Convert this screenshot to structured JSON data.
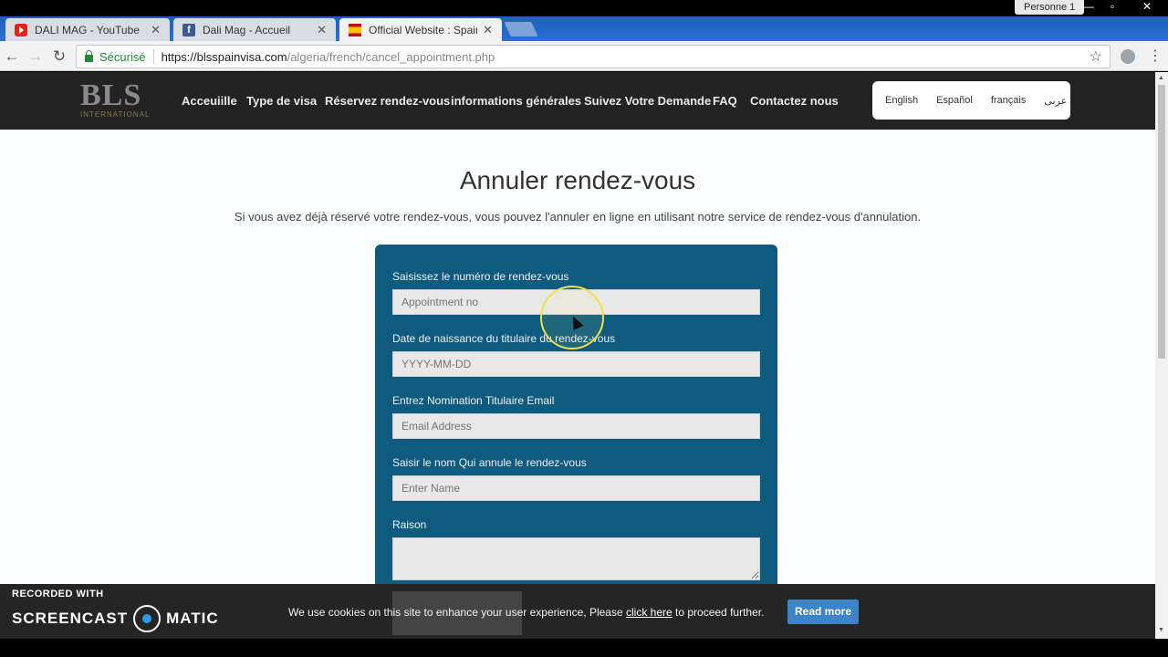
{
  "browser": {
    "tabs": [
      {
        "label": "DALI MAG - YouTube",
        "icon": "youtube-icon"
      },
      {
        "label": "Dali Mag - Accueil",
        "icon": "facebook-icon"
      },
      {
        "label": "Official Website : Spain V",
        "icon": "spain-flag-icon"
      }
    ],
    "profile": "Personne 1",
    "secure_label": "Sécurisé",
    "url_host": "https://blsspainvisa.com",
    "url_path": "/algeria/french/cancel_appointment.php"
  },
  "site": {
    "logo_text": "BLS",
    "logo_sub": "INTERNATIONAL",
    "menu": [
      "Acceuiille",
      "Type de visa",
      "Réservez rendez-vous",
      "informations générales",
      "Suivez Votre Demande",
      "FAQ",
      "Contactez nous"
    ],
    "languages": [
      "English",
      "Español",
      "français",
      "عربى"
    ]
  },
  "page": {
    "title": "Annuler rendez-vous",
    "intro": "Si vous avez déjà réservé votre rendez-vous, vous pouvez l'annuler en ligne en utilisant notre service de rendez-vous d'annulation."
  },
  "form": {
    "appointment_label": "Saisissez le numéro de rendez-vous",
    "appointment_placeholder": "Appointment no",
    "dob_label": "Date de naissance du titulaire du rendez-vous",
    "dob_placeholder": "YYYY-MM-DD",
    "email_label": "Entrez Nomination Titulaire Email",
    "email_placeholder": "Email Address",
    "name_label": "Saisir le nom Qui annule le rendez-vous",
    "name_placeholder": "Enter Name",
    "reason_label": "Raison"
  },
  "cookie": {
    "text_before": "We use cookies on this site to enhance your user experience, Please ",
    "link": "click here",
    "text_after": " to proceed further.",
    "button": "Read more"
  },
  "recorder": {
    "line1": "RECORDED WITH",
    "brand_left": "SCREENCAST",
    "brand_right": "MATIC"
  },
  "colors": {
    "form_bg": "#0e5b7f",
    "nav_bg": "#232323",
    "read_more": "#3d84c6"
  }
}
